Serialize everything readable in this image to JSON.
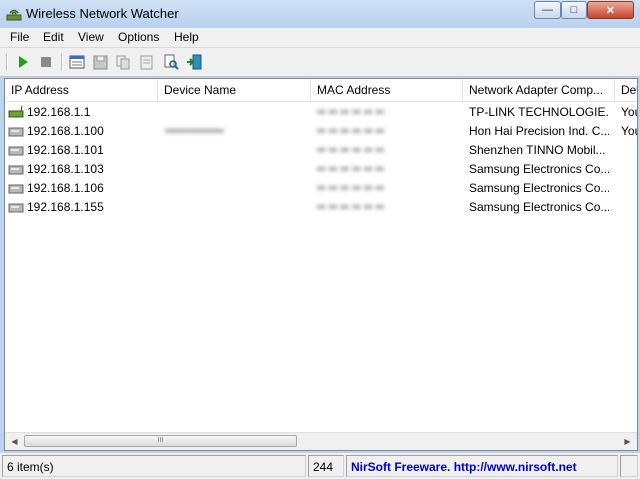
{
  "window": {
    "title": "Wireless Network Watcher"
  },
  "menu": [
    "File",
    "Edit",
    "View",
    "Options",
    "Help"
  ],
  "toolbar": {
    "icons": [
      "play-icon",
      "stop-icon",
      "properties-icon",
      "save-icon",
      "copy-icon",
      "report-icon",
      "find-icon",
      "exit-icon"
    ]
  },
  "columns": [
    "IP Address",
    "Device Name",
    "MAC Address",
    "Network Adapter Comp...",
    "Dev"
  ],
  "rows": [
    {
      "ip": "192.168.1.1",
      "device": "",
      "mac": "•• •• •• •• •• ••",
      "adapter": "TP-LINK TECHNOLOGIE...",
      "extra": "You"
    },
    {
      "ip": "192.168.1.100",
      "device": "••••••••••••••",
      "mac": "•• •• •• •• •• ••",
      "adapter": "Hon Hai Precision Ind. C...",
      "extra": "You"
    },
    {
      "ip": "192.168.1.101",
      "device": "",
      "mac": "•• •• •• •• •• ••",
      "adapter": "Shenzhen TINNO Mobil...",
      "extra": ""
    },
    {
      "ip": "192.168.1.103",
      "device": "",
      "mac": "•• •• •• •• •• ••",
      "adapter": "Samsung Electronics Co...",
      "extra": ""
    },
    {
      "ip": "192.168.1.106",
      "device": "",
      "mac": "•• •• •• •• •• ••",
      "adapter": "Samsung Electronics Co...",
      "extra": ""
    },
    {
      "ip": "192.168.1.155",
      "device": "",
      "mac": "•• •• •• •• •• ••",
      "adapter": "Samsung Electronics Co...",
      "extra": ""
    }
  ],
  "scrollbar": {
    "thumb_grip": "III"
  },
  "status": {
    "items": "6 item(s)",
    "count": "244",
    "credit": "NirSoft Freeware.  http://www.nirsoft.net"
  }
}
